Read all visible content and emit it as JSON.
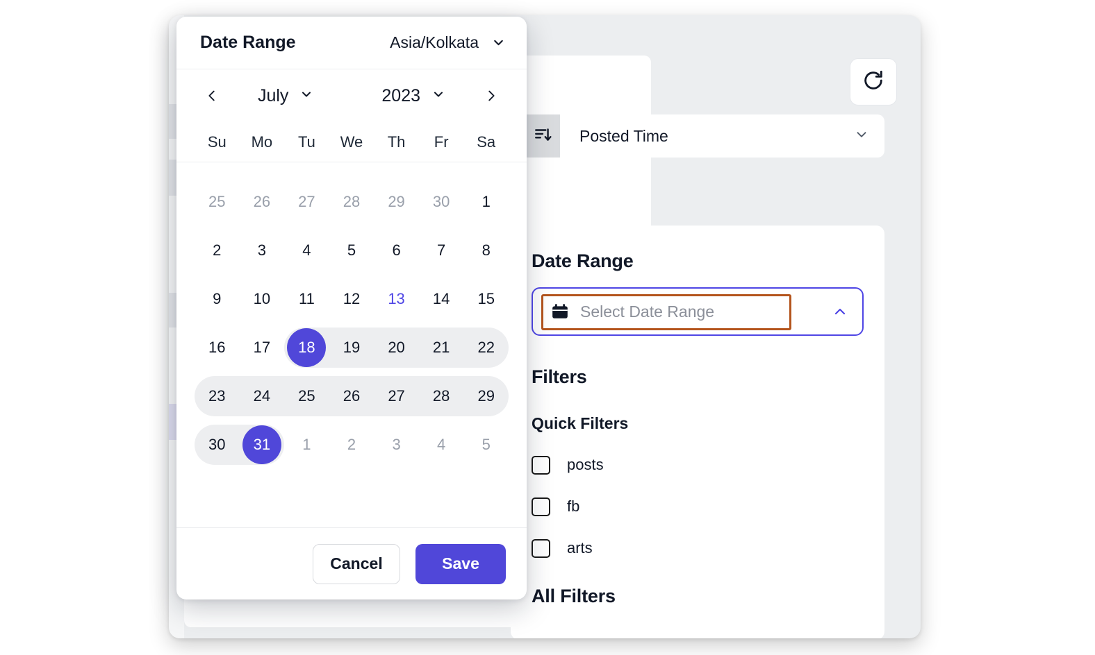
{
  "window": {
    "toolbar": {
      "refresh_icon": "refresh-icon"
    },
    "sort": {
      "icon": "sort-descending-icon",
      "selected": "Posted Time",
      "chevron_icon": "chevron-down-icon"
    }
  },
  "filter_panel": {
    "date_range_heading": "Date Range",
    "date_range_input": {
      "placeholder": "Select Date Range",
      "value": "",
      "calendar_icon": "calendar-icon",
      "chevron_icon": "chevron-up-icon",
      "focus_color": "#4f46e5",
      "annotation_color": "#b4551d"
    },
    "filters_heading": "Filters",
    "quick_filters_heading": "Quick Filters",
    "quick_filters": [
      {
        "label": "posts",
        "checked": false
      },
      {
        "label": "fb",
        "checked": false
      },
      {
        "label": "arts",
        "checked": false
      }
    ],
    "all_filters_heading": "All Filters"
  },
  "date_dialog": {
    "title": "Date Range",
    "timezone": "Asia/Kolkata",
    "timezone_chevron_icon": "chevron-down-icon",
    "prev_icon": "chevron-left-icon",
    "next_icon": "chevron-right-icon",
    "month": "July",
    "year": "2023",
    "weekdays": [
      "Su",
      "Mo",
      "Tu",
      "We",
      "Th",
      "Fr",
      "Sa"
    ],
    "weeks": [
      [
        {
          "n": "25",
          "state": "muted"
        },
        {
          "n": "26",
          "state": "muted"
        },
        {
          "n": "27",
          "state": "muted"
        },
        {
          "n": "28",
          "state": "muted"
        },
        {
          "n": "29",
          "state": "muted"
        },
        {
          "n": "30",
          "state": "muted"
        },
        {
          "n": "1",
          "state": "normal"
        }
      ],
      [
        {
          "n": "2",
          "state": "normal"
        },
        {
          "n": "3",
          "state": "normal"
        },
        {
          "n": "4",
          "state": "normal"
        },
        {
          "n": "5",
          "state": "normal"
        },
        {
          "n": "6",
          "state": "normal"
        },
        {
          "n": "7",
          "state": "normal"
        },
        {
          "n": "8",
          "state": "normal"
        }
      ],
      [
        {
          "n": "9",
          "state": "normal"
        },
        {
          "n": "10",
          "state": "normal"
        },
        {
          "n": "11",
          "state": "normal"
        },
        {
          "n": "12",
          "state": "normal"
        },
        {
          "n": "13",
          "state": "today"
        },
        {
          "n": "14",
          "state": "normal"
        },
        {
          "n": "15",
          "state": "normal"
        }
      ],
      [
        {
          "n": "16",
          "state": "normal"
        },
        {
          "n": "17",
          "state": "normal"
        },
        {
          "n": "18",
          "state": "endpoint"
        },
        {
          "n": "19",
          "state": "inrange"
        },
        {
          "n": "20",
          "state": "inrange"
        },
        {
          "n": "21",
          "state": "inrange"
        },
        {
          "n": "22",
          "state": "inrange"
        }
      ],
      [
        {
          "n": "23",
          "state": "inrange"
        },
        {
          "n": "24",
          "state": "inrange"
        },
        {
          "n": "25",
          "state": "inrange"
        },
        {
          "n": "26",
          "state": "inrange"
        },
        {
          "n": "27",
          "state": "inrange"
        },
        {
          "n": "28",
          "state": "inrange"
        },
        {
          "n": "29",
          "state": "inrange"
        }
      ],
      [
        {
          "n": "30",
          "state": "inrange"
        },
        {
          "n": "31",
          "state": "endpoint"
        },
        {
          "n": "1",
          "state": "muted"
        },
        {
          "n": "2",
          "state": "muted"
        },
        {
          "n": "3",
          "state": "muted"
        },
        {
          "n": "4",
          "state": "muted"
        },
        {
          "n": "5",
          "state": "muted"
        }
      ]
    ],
    "selection": {
      "start": "2023-07-18",
      "end": "2023-07-31"
    },
    "cancel_label": "Cancel",
    "save_label": "Save",
    "accent_color": "#5047d9",
    "range_band_color": "#edeef0"
  }
}
